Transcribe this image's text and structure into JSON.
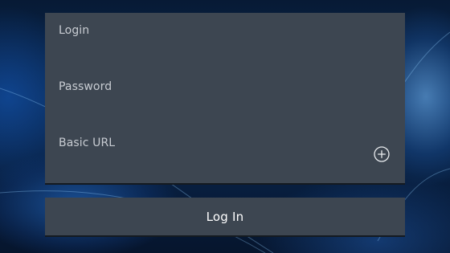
{
  "form": {
    "login_label": "Login",
    "password_label": "Password",
    "basic_url_label": "Basic URL",
    "add_icon": "plus-circle-icon",
    "submit_label": "Log In"
  },
  "colors": {
    "panel_bg": "#3d4651",
    "panel_border": "#141a20",
    "label_text": "#c8ccd2",
    "button_text": "#ffffff"
  }
}
